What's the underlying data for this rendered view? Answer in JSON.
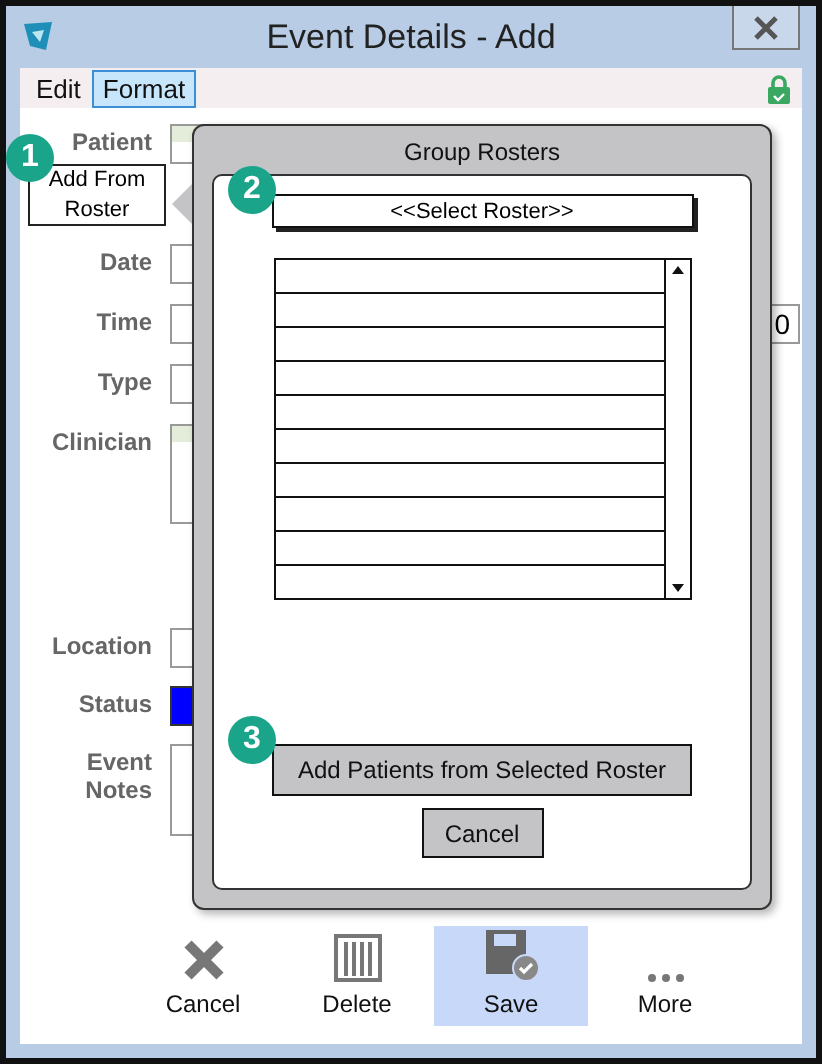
{
  "window": {
    "title": "Event Details - Add"
  },
  "menu": [
    {
      "label": "Edit",
      "selected": false
    },
    {
      "label": "Format",
      "selected": true
    }
  ],
  "form": {
    "fields": [
      {
        "label": "Patient",
        "kind": "list"
      },
      {
        "label": "Date",
        "kind": "text"
      },
      {
        "label": "Time",
        "kind": "range",
        "end_value": "0"
      },
      {
        "label": "Type",
        "kind": "text"
      },
      {
        "label": "Clinician",
        "kind": "list"
      },
      {
        "label": "Location",
        "kind": "text"
      },
      {
        "label": "Status",
        "kind": "color",
        "color": "#0000ff"
      },
      {
        "label": "Event Notes",
        "kind": "notes"
      }
    ],
    "add_from_roster_button": "Add From Roster"
  },
  "popup": {
    "title": "Group Rosters",
    "roster_select": "<<Select Roster>>",
    "add_button": "Add Patients from Selected Roster",
    "cancel_button": "Cancel"
  },
  "callouts": [
    "1",
    "2",
    "3"
  ],
  "toolbar": [
    {
      "label": "Cancel",
      "kind": "cancel",
      "selected": false
    },
    {
      "label": "Delete",
      "kind": "delete",
      "selected": false
    },
    {
      "label": "Save",
      "kind": "save",
      "selected": true
    },
    {
      "label": "More",
      "kind": "more",
      "selected": false
    }
  ]
}
